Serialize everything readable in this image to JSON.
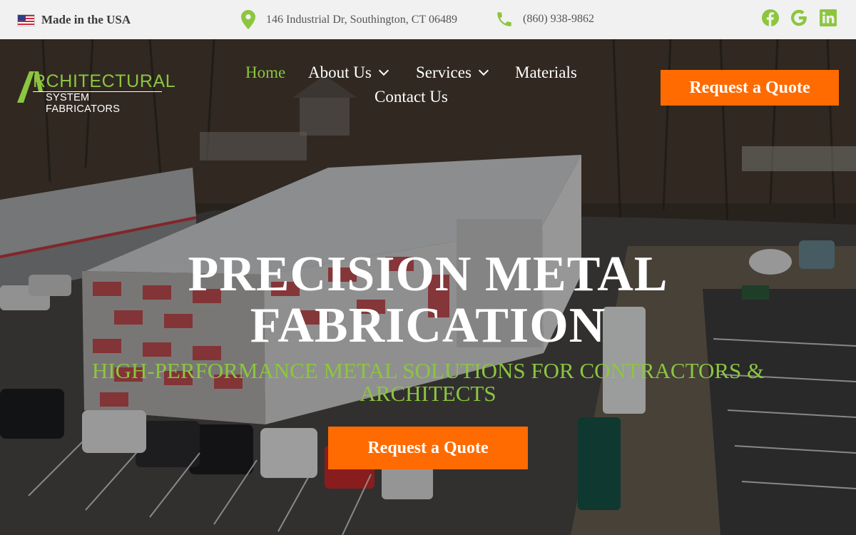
{
  "topbar": {
    "made_in": "Made in the USA",
    "address": "146 Industrial Dr, Southington, CT 06489",
    "phone": "(860) 938-9862",
    "social_icons": [
      "facebook-icon",
      "google-icon",
      "linkedin-icon"
    ],
    "icon_color": "#8cc63f"
  },
  "logo": {
    "line1": "RCHITECTURAL",
    "line2": "SYSTEM FABRICATORS"
  },
  "nav": {
    "items": [
      {
        "label": "Home",
        "active": true
      },
      {
        "label": "About Us",
        "dropdown": true
      },
      {
        "label": "Services",
        "dropdown": true
      },
      {
        "label": "Materials"
      },
      {
        "label": "Contact Us"
      }
    ]
  },
  "header_cta": "Request a Quote",
  "hero": {
    "title_line1": "PRECISION METAL",
    "title_line2": "FABRICATION",
    "subtitle_line1": "HIGH-PERFORMANCE METAL SOLUTIONS FOR CONTRACTORS &",
    "subtitle_line2": "ARCHITECTS",
    "cta": "Request a Quote"
  },
  "colors": {
    "accent_green": "#8cc63f",
    "cta_orange": "#ff6b00",
    "topbar_bg": "#f1f1f1"
  }
}
